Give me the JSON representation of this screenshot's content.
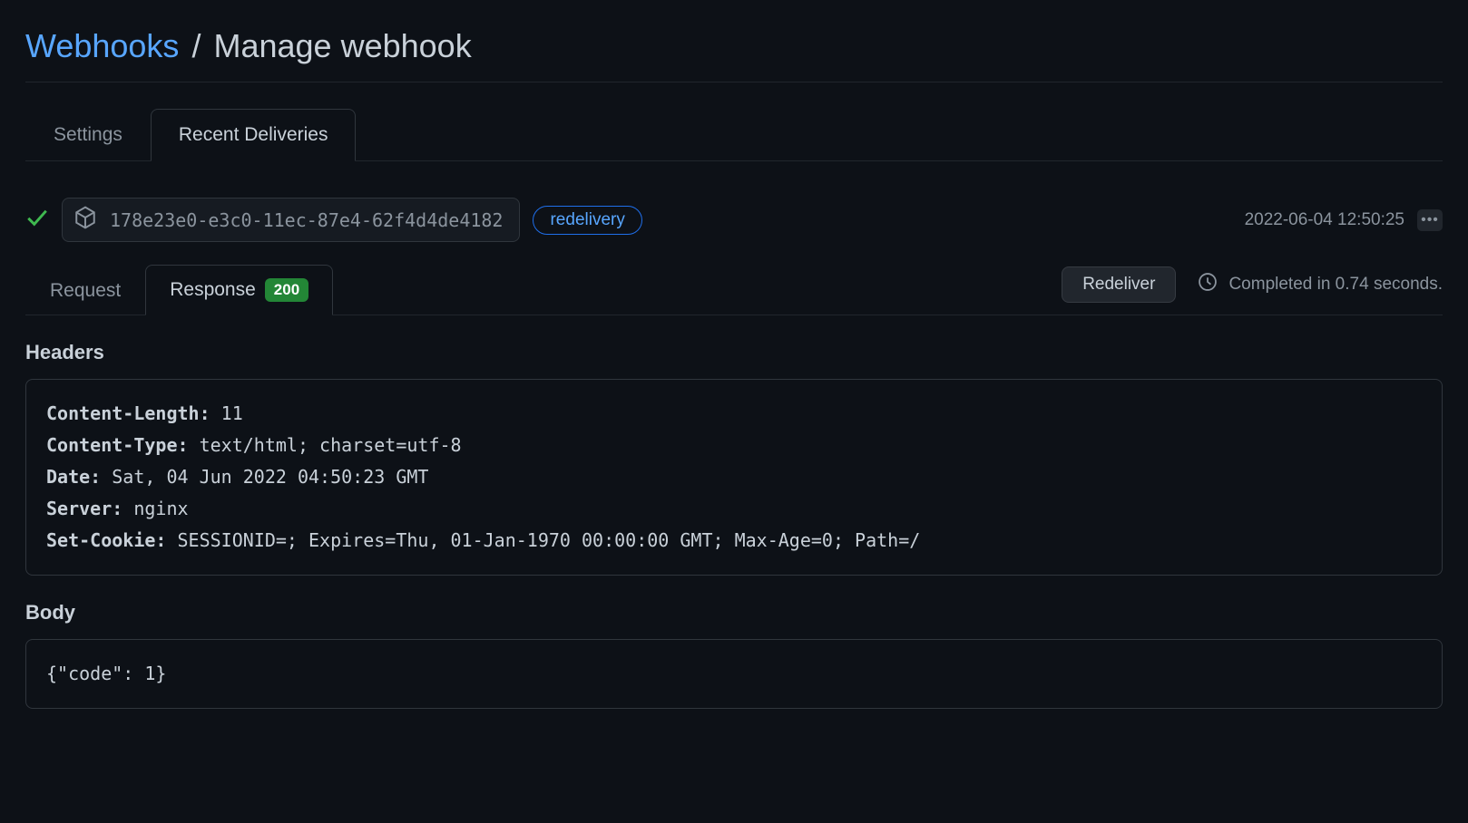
{
  "breadcrumb": {
    "link": "Webhooks",
    "slash": "/",
    "current": "Manage webhook"
  },
  "tabs_primary": {
    "settings": "Settings",
    "recent": "Recent Deliveries"
  },
  "delivery": {
    "id": "178e23e0-e3c0-11ec-87e4-62f4d4de4182",
    "redelivery_label": "redelivery",
    "timestamp": "2022-06-04 12:50:25"
  },
  "tabs_secondary": {
    "request": "Request",
    "response": "Response",
    "status_code": "200"
  },
  "actions": {
    "redeliver": "Redeliver",
    "completed": "Completed in 0.74 seconds."
  },
  "sections": {
    "headers_title": "Headers",
    "body_title": "Body"
  },
  "headers": [
    {
      "key": "Content-Length:",
      "val": " 11"
    },
    {
      "key": "Content-Type:",
      "val": " text/html; charset=utf-8"
    },
    {
      "key": "Date:",
      "val": " Sat, 04 Jun 2022 04:50:23 GMT"
    },
    {
      "key": "Server:",
      "val": " nginx"
    },
    {
      "key": "Set-Cookie:",
      "val": " SESSIONID=; Expires=Thu, 01-Jan-1970 00:00:00 GMT; Max-Age=0; Path=/"
    }
  ],
  "body_content": "{\"code\": 1}"
}
